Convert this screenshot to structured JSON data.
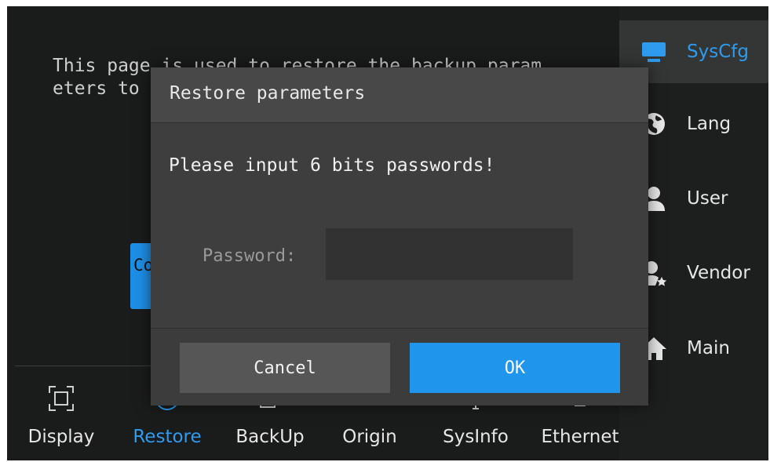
{
  "description": "This page is used to restore the backup param\neters to",
  "background_button_label": "Co",
  "sidebar": {
    "items": [
      {
        "label": "SysCfg",
        "icon": "monitor-icon",
        "active": true
      },
      {
        "label": "Lang",
        "icon": "globe-icon"
      },
      {
        "label": "User",
        "icon": "user-icon"
      },
      {
        "label": "Vendor",
        "icon": "vendor-icon"
      },
      {
        "label": "Main",
        "icon": "home-icon"
      }
    ]
  },
  "tabs": [
    {
      "label": "Display",
      "icon": "display-icon"
    },
    {
      "label": "Restore",
      "icon": "restore-icon",
      "active": true
    },
    {
      "label": "BackUp",
      "icon": "backup-icon"
    },
    {
      "label": "Origin",
      "icon": "origin-icon"
    },
    {
      "label": "SysInfo",
      "icon": "sysinfo-icon"
    },
    {
      "label": "Ethernet",
      "icon": "ethernet-icon"
    }
  ],
  "dialog": {
    "title": "Restore parameters",
    "message": "Please input 6 bits passwords!",
    "password_label": "Password:",
    "password_value": "",
    "cancel_label": "Cancel",
    "ok_label": "OK"
  },
  "colors": {
    "accent": "#2e9bef",
    "ok_button": "#1f95ec",
    "background": "#1a1b1b"
  }
}
